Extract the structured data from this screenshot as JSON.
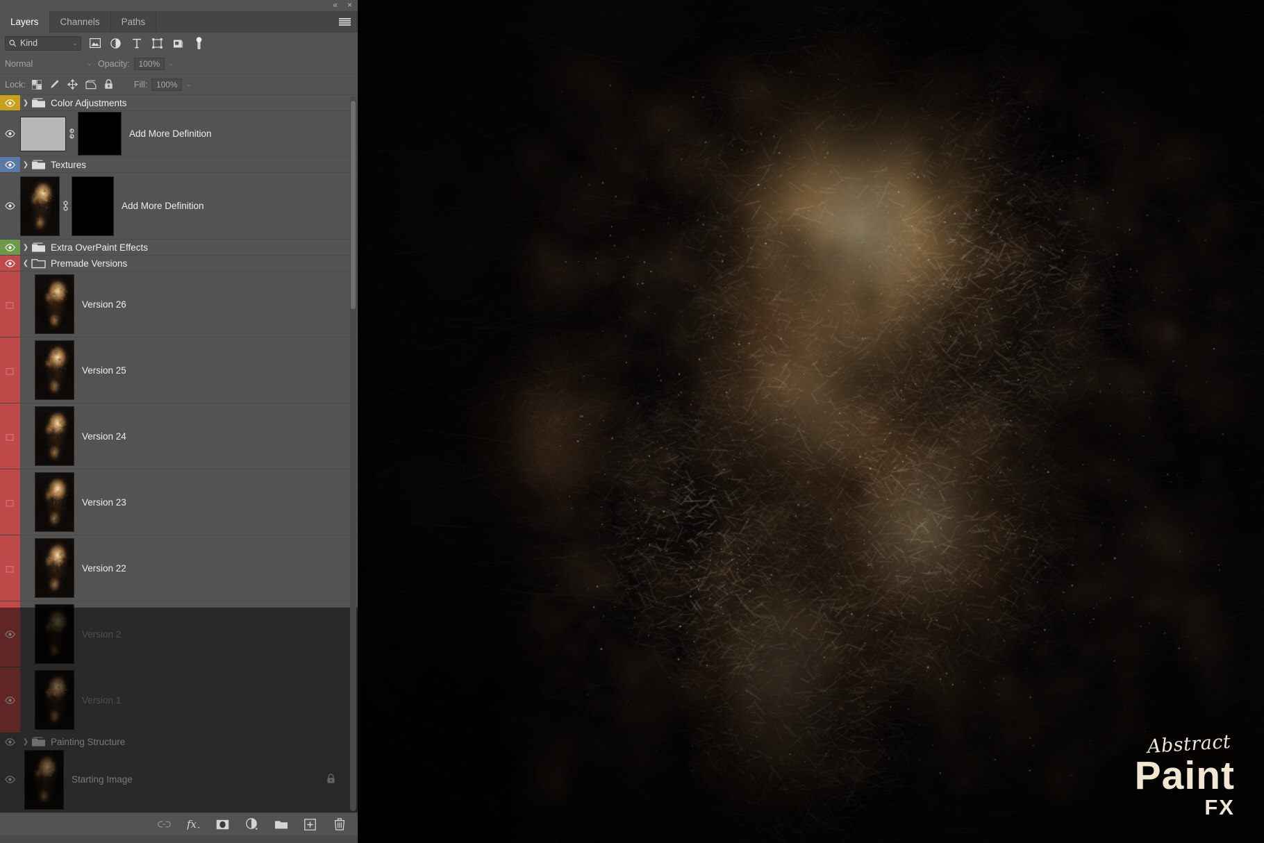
{
  "window": {
    "collapse_label": "«",
    "close_label": "×",
    "menu_icon": "hamburger-menu-icon"
  },
  "tabs": [
    {
      "label": "Layers",
      "active": true
    },
    {
      "label": "Channels",
      "active": false
    },
    {
      "label": "Paths",
      "active": false
    }
  ],
  "filter_bar": {
    "search_icon": "magnifier-icon",
    "kind_label": "Kind",
    "caret": "⌄",
    "icons": [
      {
        "name": "pixel-layer-filter-icon"
      },
      {
        "name": "adjustment-layer-filter-icon"
      },
      {
        "name": "type-layer-filter-icon"
      },
      {
        "name": "shape-layer-filter-icon"
      },
      {
        "name": "smart-object-filter-icon"
      },
      {
        "name": "filter-toggle-switch-icon"
      }
    ]
  },
  "blend_bar": {
    "mode": "Normal",
    "caret": "⌄",
    "opacity_label": "Opacity:",
    "opacity_value": "100%"
  },
  "lock_bar": {
    "lock_label": "Lock:",
    "fill_label": "Fill:",
    "fill_value": "100%",
    "icons": [
      {
        "name": "lock-transparent-pixels-icon"
      },
      {
        "name": "lock-image-pixels-icon"
      },
      {
        "name": "lock-position-icon"
      },
      {
        "name": "lock-artboard-nesting-icon"
      },
      {
        "name": "lock-all-icon"
      }
    ]
  },
  "layers": [
    {
      "id": "color-adjustments",
      "name": "Color Adjustments",
      "type": "group",
      "color": "yellow",
      "visible": true,
      "expanded": false
    },
    {
      "id": "add-more-definition-1",
      "name": "Add More Definition",
      "type": "mask-layer",
      "color": "none",
      "visible": true,
      "thumb": "gray",
      "mask": "black"
    },
    {
      "id": "textures",
      "name": "Textures",
      "type": "group",
      "color": "blue",
      "visible": true,
      "expanded": false
    },
    {
      "id": "add-more-definition-2",
      "name": "Add More Definition",
      "type": "mask-layer",
      "color": "none",
      "visible": true,
      "thumb": "portrait",
      "mask": "black"
    },
    {
      "id": "extra-overpaint-effects",
      "name": "Extra OverPaint Effects",
      "type": "group",
      "color": "green",
      "visible": true,
      "expanded": false
    },
    {
      "id": "premade-versions",
      "name": "Premade Versions",
      "type": "group",
      "color": "red",
      "visible": true,
      "expanded": true
    },
    {
      "id": "version-26",
      "name": "Version 26",
      "type": "child",
      "color": "red",
      "visible": false
    },
    {
      "id": "version-25",
      "name": "Version 25",
      "type": "child",
      "color": "red",
      "visible": false
    },
    {
      "id": "version-24",
      "name": "Version 24",
      "type": "child",
      "color": "red",
      "visible": false
    },
    {
      "id": "version-23",
      "name": "Version 23",
      "type": "child",
      "color": "red",
      "visible": false
    },
    {
      "id": "version-22",
      "name": "Version 22",
      "type": "child",
      "color": "red",
      "visible": false
    },
    {
      "id": "version-2",
      "name": "Version 2",
      "type": "child",
      "color": "red",
      "visible": true
    },
    {
      "id": "version-1",
      "name": "Version 1",
      "type": "child",
      "color": "red",
      "visible": true
    },
    {
      "id": "painting-structure",
      "name": "Painting Structure",
      "type": "group",
      "color": "none",
      "visible": true,
      "expanded": false
    },
    {
      "id": "starting-image",
      "name": "Starting Image",
      "type": "image",
      "color": "none",
      "visible": true,
      "locked": true
    }
  ],
  "bottom_bar": {
    "icons": [
      {
        "name": "link-layers-icon",
        "disabled": true
      },
      {
        "name": "layer-style-fx-icon",
        "disabled": false
      },
      {
        "name": "add-layer-mask-icon",
        "disabled": false
      },
      {
        "name": "new-adjustment-layer-icon",
        "disabled": false
      },
      {
        "name": "new-group-icon",
        "disabled": false
      },
      {
        "name": "new-layer-icon",
        "disabled": false
      },
      {
        "name": "delete-layer-icon",
        "disabled": false
      }
    ]
  },
  "watermark": {
    "script": "Abstract",
    "main": "Paint",
    "sub": "FX"
  },
  "theme": {
    "panel_bg": "#535353",
    "tabbar_bg": "#454545",
    "label_yellow": "#c8a01e",
    "label_blue": "#5a78a8",
    "label_green": "#6c9a4a",
    "label_red": "#c04a4a",
    "text": "#ededed"
  }
}
